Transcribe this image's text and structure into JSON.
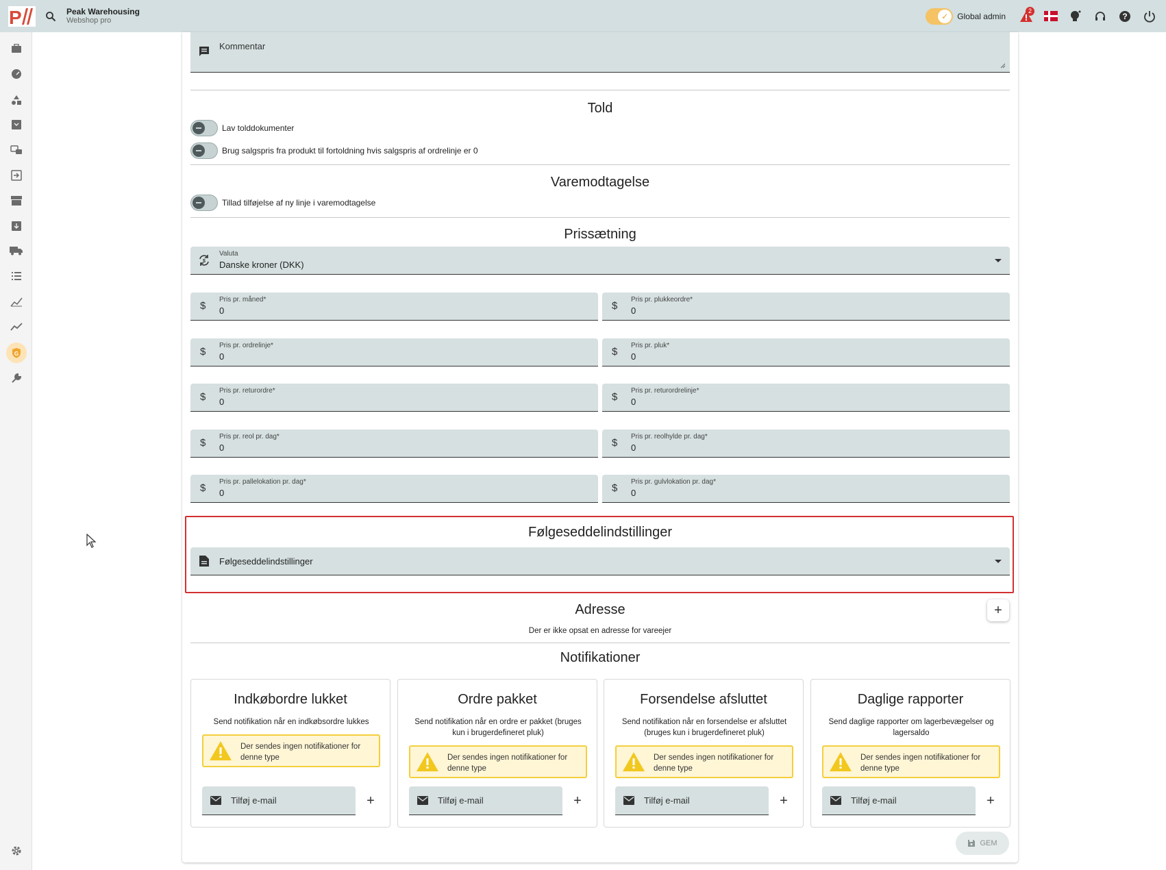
{
  "topbar": {
    "brand_name": "Peak Warehousing",
    "brand_sub": "Webshop pro",
    "global_admin_label": "Global admin",
    "notification_count": "2",
    "global_admin_enabled": true
  },
  "sidebar": {
    "items": [
      "briefcase-icon",
      "dashboard-icon",
      "shapes-icon",
      "inbox-icon",
      "move-icon",
      "login-icon",
      "store-icon",
      "archive-down-icon",
      "truck-icon",
      "list-icon",
      "chart-icon",
      "trend-icon",
      "shield-g-icon",
      "wrench-icon"
    ],
    "active": "shield-g-icon",
    "settings_icon": "gear-icon"
  },
  "form": {
    "kommentar_label": "Kommentar",
    "told": {
      "title": "Told",
      "toggle_1": "Lav tolddokumenter",
      "toggle_2": "Brug salgspris fra produkt til fortoldning hvis salgspris af ordrelinje er 0"
    },
    "varemodtagelse": {
      "title": "Varemodtagelse",
      "toggle_1": "Tillad tilføjelse af ny linje i varemodtagelse"
    },
    "prissaetning": {
      "title": "Prissætning",
      "valuta_label": "Valuta",
      "valuta_value": "Danske kroner (DKK)",
      "fields": [
        {
          "label": "Pris pr. måned*",
          "value": "0"
        },
        {
          "label": "Pris pr. plukkeordre*",
          "value": "0"
        },
        {
          "label": "Pris pr. ordrelinje*",
          "value": "0"
        },
        {
          "label": "Pris pr. pluk*",
          "value": "0"
        },
        {
          "label": "Pris pr. returordre*",
          "value": "0"
        },
        {
          "label": "Pris pr. returordrelinje*",
          "value": "0"
        },
        {
          "label": "Pris pr. reol pr. dag*",
          "value": "0"
        },
        {
          "label": "Pris pr. reolhylde pr. dag*",
          "value": "0"
        },
        {
          "label": "Pris pr. pallelokation pr. dag*",
          "value": "0"
        },
        {
          "label": "Pris pr. gulvlokation pr. dag*",
          "value": "0"
        }
      ],
      "currency_symbol": "$"
    },
    "folgeseddel": {
      "title": "Følgeseddelindstillinger",
      "select_placeholder": "Følgeseddelindstillinger"
    },
    "adresse": {
      "title": "Adresse",
      "empty_text": "Der er ikke opsat en adresse for vareejer"
    },
    "notifikationer": {
      "title": "Notifikationer",
      "cards": [
        {
          "title": "Indkøbordre lukket",
          "desc": "Send notifikation når en indkøbsordre lukkes",
          "warning": "Der sendes ingen notifikationer for denne type",
          "email_placeholder": "Tilføj e-mail"
        },
        {
          "title": "Ordre pakket",
          "desc": "Send notifikation når en ordre er pakket (bruges kun i brugerdefineret pluk)",
          "warning": "Der sendes ingen notifikationer for denne type",
          "email_placeholder": "Tilføj e-mail"
        },
        {
          "title": "Forsendelse afsluttet",
          "desc": "Send notifikation når en forsendelse er afsluttet (bruges kun i brugerdefineret pluk)",
          "warning": "Der sendes ingen notifikationer for denne type",
          "email_placeholder": "Tilføj e-mail"
        },
        {
          "title": "Daglige rapporter",
          "desc": "Send daglige rapporter om lagerbevægelser og lagersaldo",
          "warning": "Der sendes ingen notifikationer for denne type",
          "email_placeholder": "Tilføj e-mail"
        }
      ]
    },
    "save_label": "GEM"
  },
  "colors": {
    "topbar_bg": "#d3dfe0",
    "field_bg": "#d6e0e0",
    "accent_orange": "#f5c264",
    "highlight_red": "#d32f2f",
    "warning_bg": "#fff6d6",
    "warning_border": "#f3cf3c"
  }
}
